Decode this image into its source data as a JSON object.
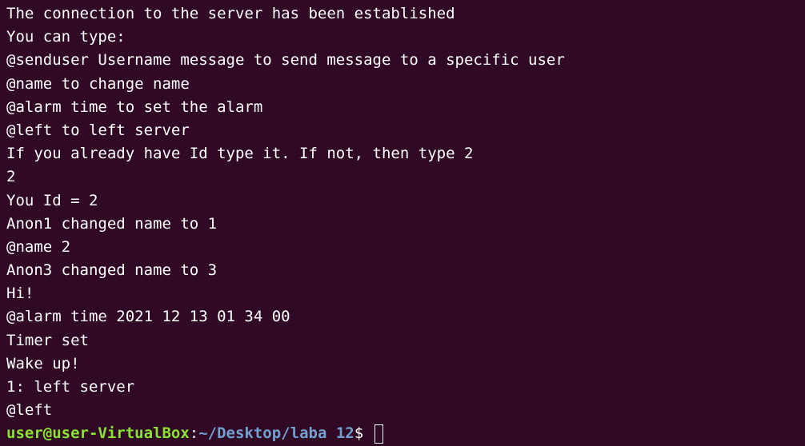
{
  "terminal": {
    "lines": [
      "The connection to the server has been established",
      "You can type:",
      "@senduser Username message to send message to a specific user",
      "@name to change name",
      "@alarm time to set the alarm",
      "@left to left server",
      "If you already have Id type it. If not, then type 2",
      "2",
      "You Id = 2",
      "Anon1 changed name to 1",
      "@name 2",
      "Anon3 changed name to 3",
      "Hi!",
      "@alarm time 2021 12 13 01 34 00",
      "Timer set",
      "Wake up!",
      "1: left server",
      "@left"
    ],
    "prompt": {
      "user_host": "user@user-VirtualBox",
      "colon": ":",
      "path": "~/Desktop/laba 12",
      "symbol": "$ "
    }
  },
  "colors": {
    "background": "#300a24",
    "text": "#ffffff",
    "prompt_user": "#8ae234",
    "prompt_path": "#729fcf"
  }
}
